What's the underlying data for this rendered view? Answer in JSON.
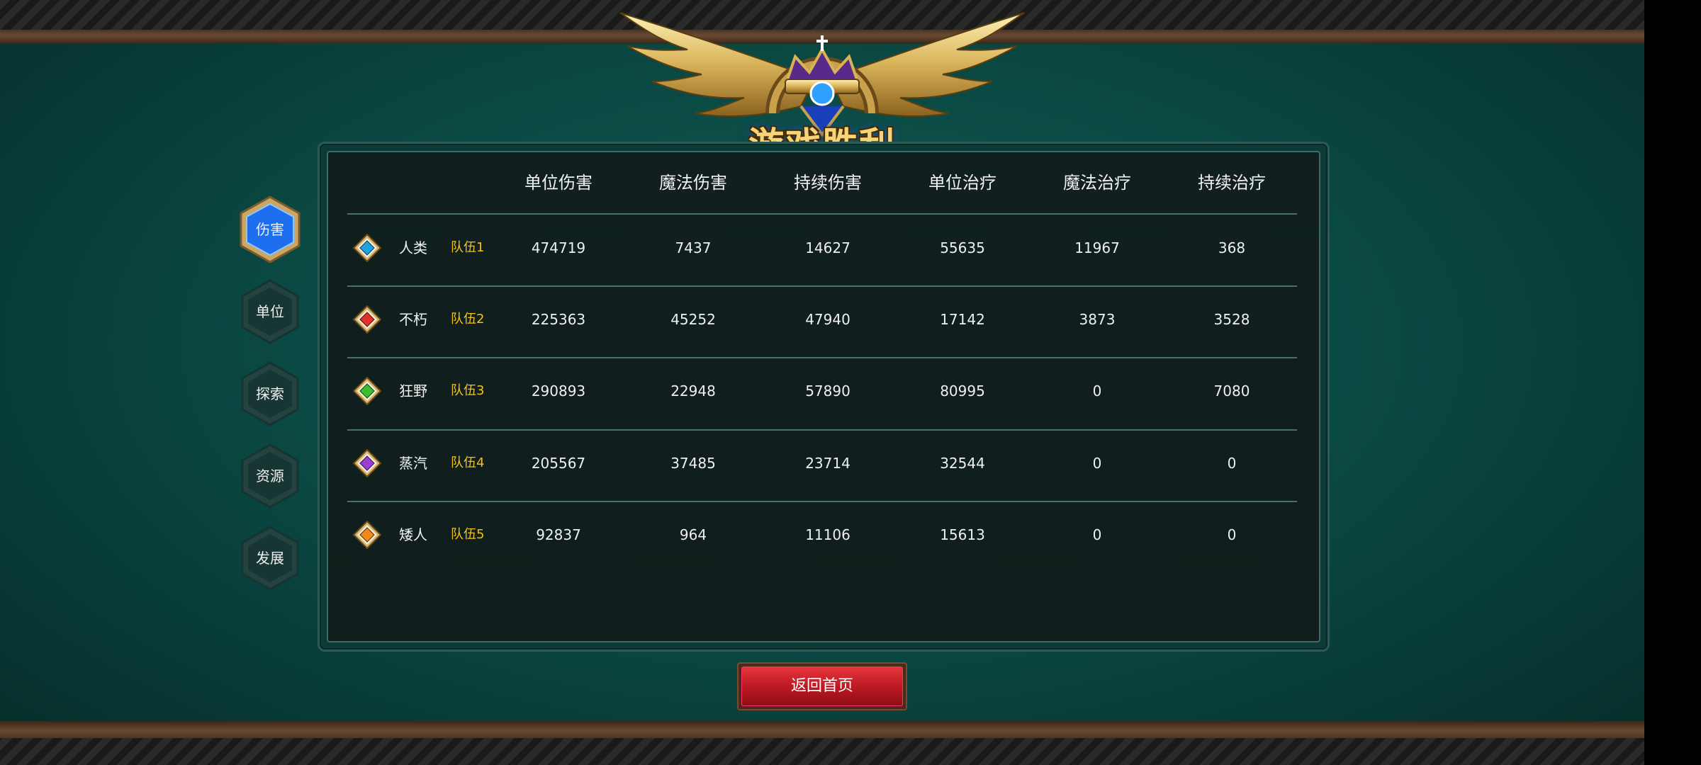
{
  "title": "游戏胜利",
  "tabs": [
    {
      "label": "伤害",
      "active": true
    },
    {
      "label": "单位",
      "active": false
    },
    {
      "label": "探索",
      "active": false
    },
    {
      "label": "资源",
      "active": false
    },
    {
      "label": "发展",
      "active": false
    }
  ],
  "columns": [
    "单位伤害",
    "魔法伤害",
    "持续伤害",
    "单位治疗",
    "魔法治疗",
    "持续治疗"
  ],
  "rows": [
    {
      "race": "人类",
      "team": "队伍1",
      "gem_color": "#1fa3e0",
      "values": [
        "474719",
        "7437",
        "14627",
        "55635",
        "11967",
        "368"
      ]
    },
    {
      "race": "不朽",
      "team": "队伍2",
      "gem_color": "#e0332c",
      "values": [
        "225363",
        "45252",
        "47940",
        "17142",
        "3873",
        "3528"
      ]
    },
    {
      "race": "狂野",
      "team": "队伍3",
      "gem_color": "#3cbf2e",
      "values": [
        "290893",
        "22948",
        "57890",
        "80995",
        "0",
        "7080"
      ]
    },
    {
      "race": "蒸汽",
      "team": "队伍4",
      "gem_color": "#9a3fd0",
      "values": [
        "205567",
        "37485",
        "23714",
        "32544",
        "0",
        "0"
      ]
    },
    {
      "race": "矮人",
      "team": "队伍5",
      "gem_color": "#f08a1a",
      "values": [
        "92837",
        "964",
        "11106",
        "15613",
        "0",
        "0"
      ]
    }
  ],
  "back_button": "返回首页",
  "colors": {
    "team_label": "#f2c21a",
    "active_tab": "#1e6ff0",
    "button": "#c81e28"
  }
}
